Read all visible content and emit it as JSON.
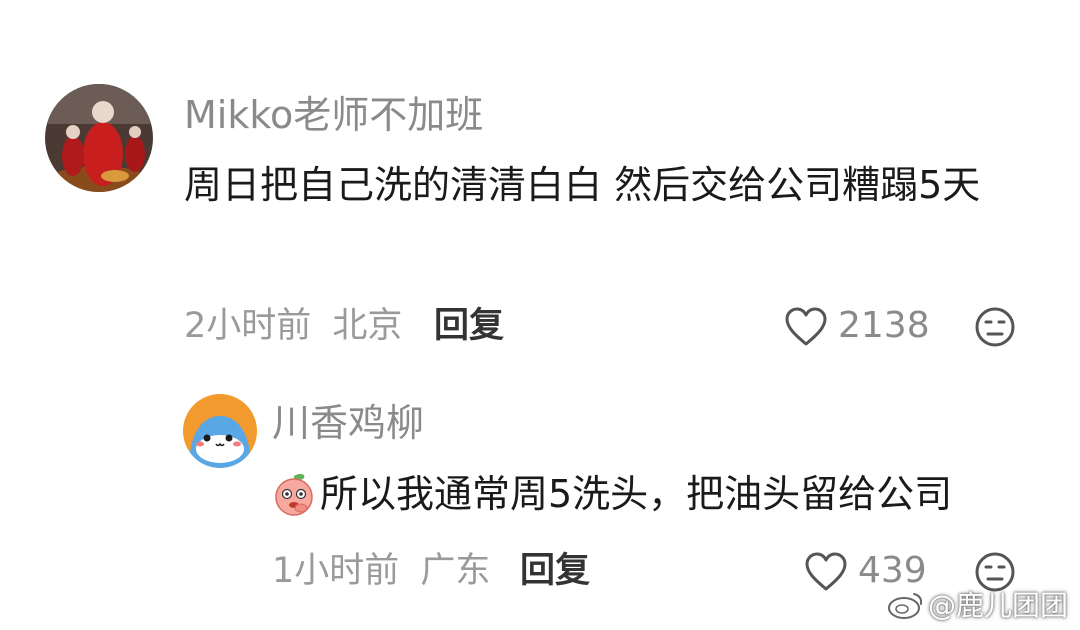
{
  "comment": {
    "username": "Mikko老师不加班",
    "text": "周日把自己洗的清清白白 然后交给公司糟蹋5天",
    "time": "2小时前",
    "location": "北京",
    "reply_label": "回复",
    "likes": "2138"
  },
  "reply": {
    "username": "川香鸡柳",
    "text": "所以我通常周5洗头，把油头留给公司",
    "time": "1小时前",
    "location": "广东",
    "reply_label": "回复",
    "likes": "439"
  },
  "watermark": "@鹿儿团团",
  "icons": {
    "like": "heart-outline-icon",
    "dislike": "neutral-face-icon",
    "emoji": "peach-emoji-icon",
    "watermark": "weibo-icon"
  }
}
